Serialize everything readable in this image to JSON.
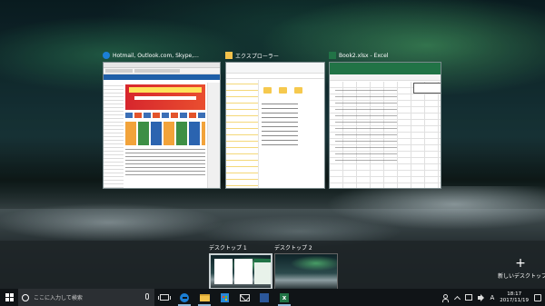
{
  "taskview": {
    "windows": [
      {
        "title": "Hotmail, Outlook.com, Skype,...",
        "app": "edge",
        "icon_color": "#1b7fd6"
      },
      {
        "title": "エクスプローラー",
        "app": "explorer",
        "icon_color": "#f3c24b"
      },
      {
        "title": "Book2.xlsx - Excel",
        "app": "excel",
        "icon_color": "#217346"
      }
    ],
    "desktops": [
      {
        "label": "デスクトップ 1",
        "active": true
      },
      {
        "label": "デスクトップ 2",
        "active": false
      }
    ],
    "new_desktop_label": "新しいデスクトップ",
    "new_desktop_symbol": "+"
  },
  "taskbar": {
    "search_placeholder": "ここに入力して検索",
    "apps": [
      "task-view",
      "edge",
      "file-explorer",
      "store",
      "mail",
      "word",
      "excel"
    ],
    "excel_glyph": "x",
    "ime_indicator": "A",
    "time": "18:17",
    "date": "2017/11/19"
  },
  "colors": {
    "taskbar": "#101417",
    "search_box": "#2b2f33",
    "excel_green": "#217346",
    "edge_blue": "#1b7fd6"
  }
}
